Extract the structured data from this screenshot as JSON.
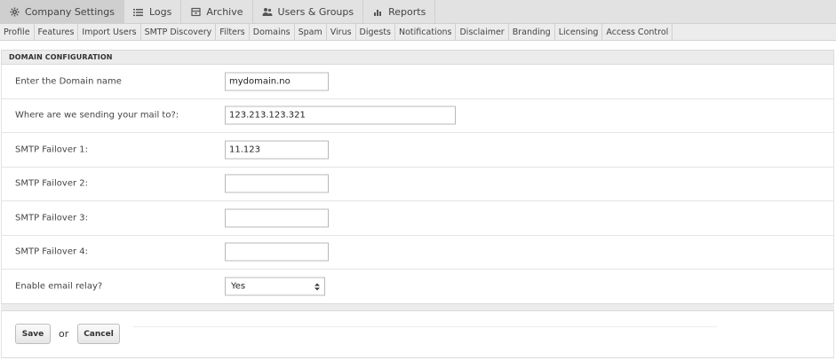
{
  "top_tabs": [
    {
      "label": "Company Settings",
      "icon": "gear-icon",
      "active": true
    },
    {
      "label": "Logs",
      "icon": "list-icon",
      "active": false
    },
    {
      "label": "Archive",
      "icon": "archive-icon",
      "active": false
    },
    {
      "label": "Users & Groups",
      "icon": "users-icon",
      "active": false
    },
    {
      "label": "Reports",
      "icon": "bar-chart-icon",
      "active": false
    }
  ],
  "sub_nav": [
    "Profile",
    "Features",
    "Import Users",
    "SMTP Discovery",
    "Filters",
    "Domains",
    "Spam",
    "Virus",
    "Digests",
    "Notifications",
    "Disclaimer",
    "Branding",
    "Licensing",
    "Access Control"
  ],
  "section_title": "DOMAIN CONFIGURATION",
  "form": {
    "rows": [
      {
        "label": "Enter the Domain name",
        "value": "mydomain.no"
      },
      {
        "label": "Where are we sending your mail to?:",
        "value": "123.213.123.321"
      },
      {
        "label": "SMTP Failover 1:",
        "value": "11.123"
      },
      {
        "label": "SMTP Failover 2:",
        "value": ""
      },
      {
        "label": "SMTP Failover 3:",
        "value": ""
      },
      {
        "label": "SMTP Failover 4:",
        "value": ""
      }
    ],
    "relay": {
      "label": "Enable email relay?",
      "selected": "Yes"
    }
  },
  "footer": {
    "save_label": "Save",
    "or_text": "or",
    "cancel_label": "Cancel"
  }
}
